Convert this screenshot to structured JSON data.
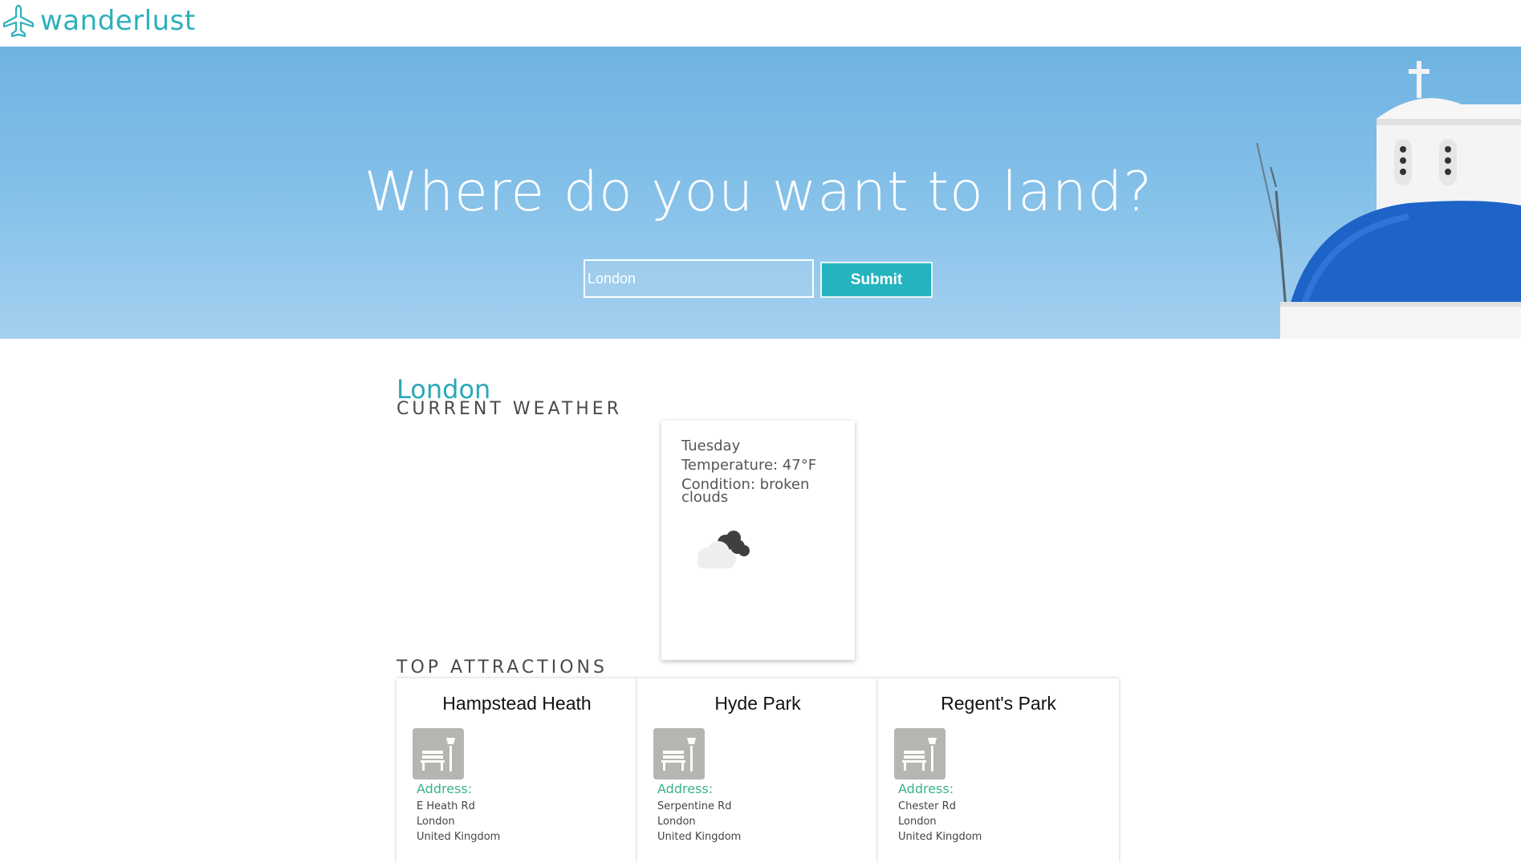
{
  "brand": {
    "name": "wanderlust",
    "logo_icon": "airplane-icon",
    "accent": "#2bb0bd"
  },
  "hero": {
    "title": "Where do you want to land?",
    "search_value": "London",
    "submit_label": "Submit"
  },
  "results": {
    "city": "London",
    "weather_heading": "CURRENT WEATHER",
    "weather": {
      "day": "Tuesday",
      "temperature": "Temperature: 47°F",
      "condition": "Condition: broken clouds",
      "icon": "broken-clouds-icon"
    },
    "attractions_heading": "TOP ATTRACTIONS",
    "attractions": [
      {
        "name": "Hampstead Heath",
        "icon": "park-bench-icon",
        "address_label": "Address:",
        "address": [
          "E Heath Rd",
          "London",
          "United Kingdom"
        ]
      },
      {
        "name": "Hyde Park",
        "icon": "park-bench-icon",
        "address_label": "Address:",
        "address": [
          "Serpentine Rd",
          "London",
          "United Kingdom"
        ]
      },
      {
        "name": "Regent's Park",
        "icon": "park-bench-icon",
        "address_label": "Address:",
        "address": [
          "Chester Rd",
          "London",
          "United Kingdom"
        ]
      }
    ]
  }
}
